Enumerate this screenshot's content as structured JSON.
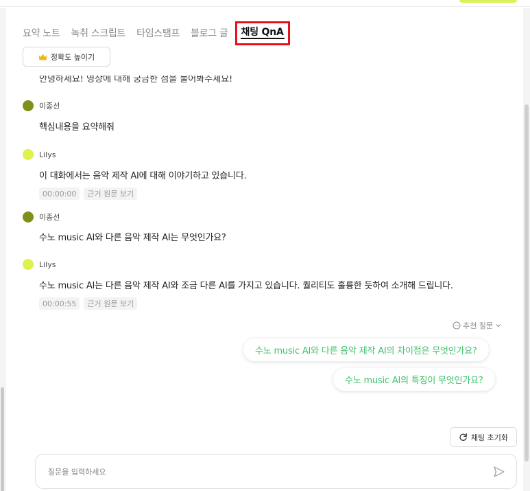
{
  "tabs": [
    {
      "label": "요약 노트"
    },
    {
      "label": "녹취 스크립트"
    },
    {
      "label": "타임스탬프"
    },
    {
      "label": "블로그 글"
    },
    {
      "label": "채팅 QnA"
    }
  ],
  "accuracy_button": {
    "label": "정확도 높이기",
    "icon": "crown-icon"
  },
  "previous_message_text": "안녕하세요! 영상에 대해 궁금한 점을 물어봐주세요!",
  "messages": [
    {
      "author": "이종선",
      "role": "user",
      "text": "핵심내용을 요약해줘"
    },
    {
      "author": "Lilys",
      "role": "bot",
      "text": "이 대화에서는 음악 제작 AI에 대해 이야기하고 있습니다.",
      "timestamp": "00:00:00",
      "source_link": "근거 원문 보기"
    },
    {
      "author": "이종선",
      "role": "user",
      "text": "수노 music AI와 다른 음악 제작 AI는 무엇인가요?"
    },
    {
      "author": "Lilys",
      "role": "bot",
      "text": "수노 music AI는 다른 음악 제작 AI와 조금 다른 AI를 가지고 있습니다. 퀄리티도 훌륭한 듯하여 소개해 드립니다.",
      "timestamp": "00:00:55",
      "source_link": "근거 원문 보기"
    }
  ],
  "recommended": {
    "toggle_label": "추천 질문",
    "questions": [
      "수노 music AI와 다른 음악 제작 AI의 차이점은 무엇인가요?",
      "수노 music AI의 특징이 무엇인가요?"
    ]
  },
  "reset_button": {
    "label": "채팅 초기화"
  },
  "input": {
    "placeholder": "질문을 입력하세요",
    "value": ""
  },
  "colors": {
    "active_tab_highlight": "#e8101c",
    "user_avatar": "#7f8f1a",
    "bot_avatar": "#ddf24a",
    "recommended_text": "#3ec26a",
    "brand_accent": "#d9f25a"
  }
}
